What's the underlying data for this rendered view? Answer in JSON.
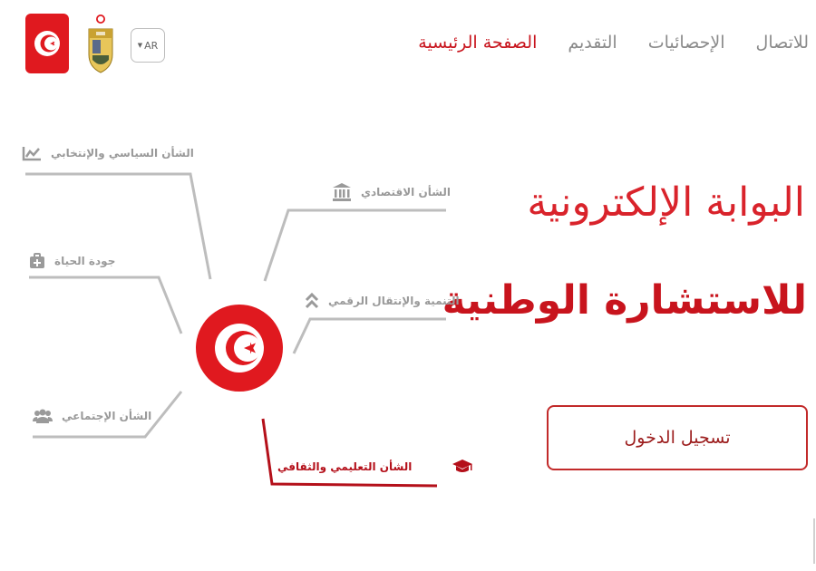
{
  "nav": {
    "items": [
      {
        "label": "الصفحة الرئيسية",
        "active": true
      },
      {
        "label": "التقديم",
        "active": false
      },
      {
        "label": "الإحصائيات",
        "active": false
      },
      {
        "label": "للاتصال",
        "active": false
      }
    ]
  },
  "lang": {
    "label": "AR"
  },
  "hero": {
    "title_line1": "البوابة الإلكترونية",
    "title_line2": "للاستشارة الوطنية",
    "login_label": "تسجيل الدخول"
  },
  "diagram": {
    "topics": [
      {
        "label": "الشأن السياسي والإنتخابي",
        "icon": "chart-icon"
      },
      {
        "label": "جودة الحياة",
        "icon": "medkit-icon"
      },
      {
        "label": "الشأن الإجتماعي",
        "icon": "users-icon"
      },
      {
        "label": "الشأن الاقتصادي",
        "icon": "bank-icon"
      },
      {
        "label": "التنمية والإنتقال الرقمي",
        "icon": "chevrons-up-icon"
      },
      {
        "label": "الشأن التعليمي والثقافي",
        "icon": "graduation-cap-icon"
      }
    ]
  },
  "colors": {
    "accent": "#c8141d",
    "flag_red": "#e0191f",
    "grey_text": "#8a8a8a",
    "line": "#bdbdbd"
  }
}
